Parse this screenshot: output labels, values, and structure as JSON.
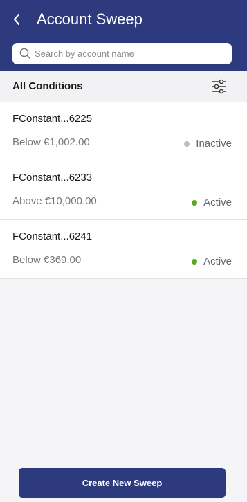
{
  "header": {
    "title": "Account Sweep",
    "back_icon": "chevron-left-icon"
  },
  "search": {
    "placeholder": "Search by account name",
    "value": "",
    "icon": "search-icon"
  },
  "conditions": {
    "title": "All Conditions",
    "filter_icon": "sliders-icon"
  },
  "sweeps": [
    {
      "account": "FConstant...6225",
      "condition": "Below €1,002.00",
      "status": "Inactive",
      "status_color": "#bdbdbd"
    },
    {
      "account": "FConstant...6233",
      "condition": "Above €10,000.00",
      "status": "Active",
      "status_color": "#55aa1f"
    },
    {
      "account": "FConstant...6241",
      "condition": "Below €369.00",
      "status": "Active",
      "status_color": "#55aa1f"
    }
  ],
  "footer": {
    "create_label": "Create New Sweep"
  },
  "colors": {
    "brand": "#2d3a7e",
    "active": "#55aa1f",
    "inactive": "#bdbdbd"
  }
}
